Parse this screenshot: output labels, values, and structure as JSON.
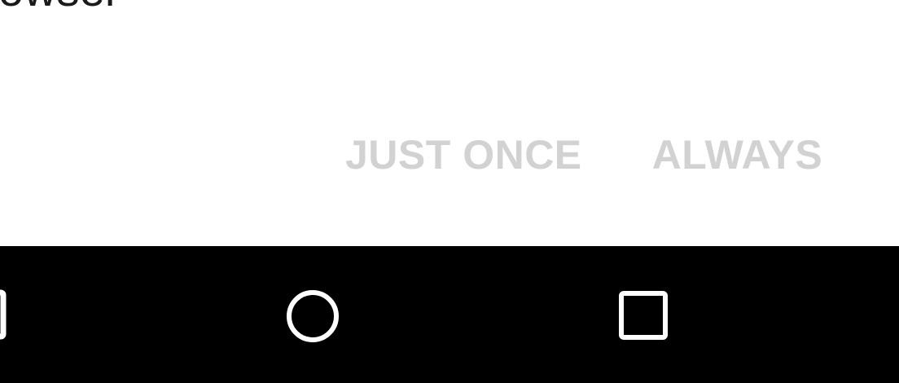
{
  "dialog": {
    "partial_label": "owser",
    "actions": {
      "just_once_label": "JUST ONCE",
      "always_label": "ALWAYS"
    },
    "colors": {
      "background": "#ffffff",
      "action_text_disabled": "#d2d2d2",
      "title_text": "#1a1a1a"
    }
  },
  "navbar": {
    "background": "#000000",
    "icons": {
      "back": "back-triangle-icon",
      "home": "home-circle-icon",
      "recents": "recents-square-icon"
    },
    "icon_color": "#ffffff"
  }
}
